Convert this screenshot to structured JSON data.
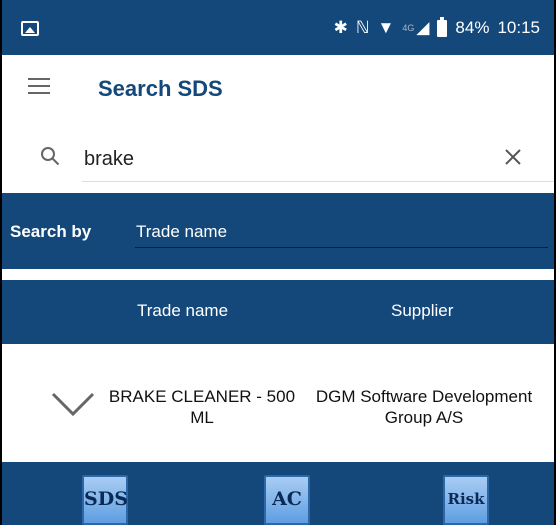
{
  "status": {
    "signal_label": "4G",
    "battery": "84%",
    "time": "10:15"
  },
  "header": {
    "title": "Search SDS"
  },
  "search": {
    "query": "brake"
  },
  "search_by": {
    "label": "Search by",
    "value": "Trade name"
  },
  "table": {
    "headers": [
      "Trade name",
      "Supplier"
    ],
    "rows": [
      {
        "trade_name": "BRAKE CLEANER - 500 ML",
        "supplier": "DGM Software Development Group A/S"
      }
    ]
  },
  "bottom": {
    "buttons": [
      "SDS",
      "AC",
      "Risk"
    ]
  },
  "colors": {
    "primary": "#14487a",
    "button_gradient_top": "#a9cdf3",
    "button_gradient_bottom": "#5e9ee2"
  }
}
